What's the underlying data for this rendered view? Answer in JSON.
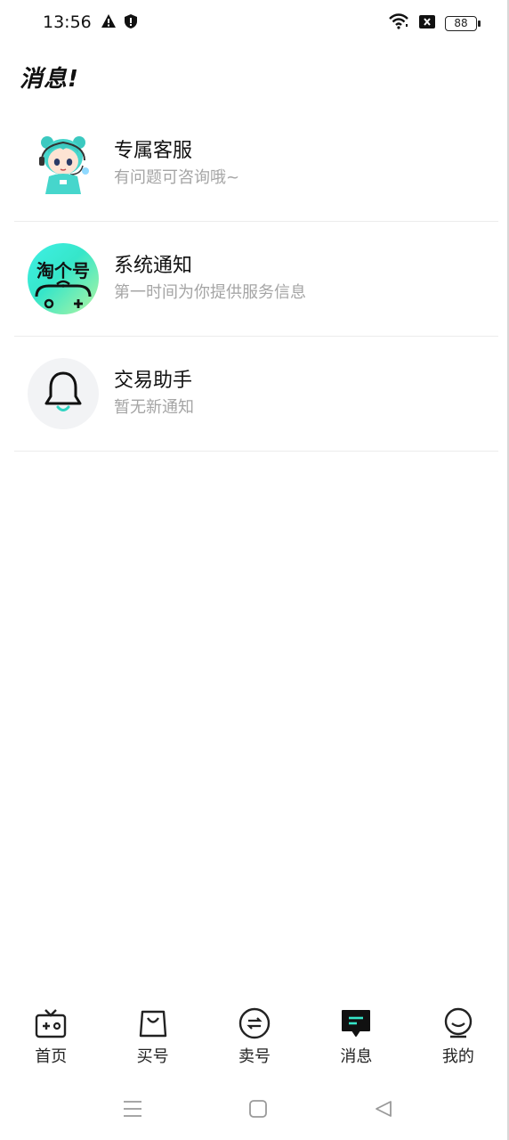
{
  "status_bar": {
    "time": "13:56",
    "battery": "88"
  },
  "page": {
    "title": "消息!"
  },
  "messages": [
    {
      "title": "专属客服",
      "subtitle": "有问题可咨询哦~",
      "avatar_icon": "customer-service-avatar"
    },
    {
      "title": "系统通知",
      "subtitle": "第一时间为你提供服务信息",
      "avatar_icon": "taogehao-logo",
      "avatar_text": "淘个号"
    },
    {
      "title": "交易助手",
      "subtitle": "暂无新通知",
      "avatar_icon": "bell-icon"
    }
  ],
  "tabs": [
    {
      "label": "首页",
      "icon": "home-tv-icon",
      "active": false
    },
    {
      "label": "买号",
      "icon": "shopping-bag-icon",
      "active": false
    },
    {
      "label": "卖号",
      "icon": "exchange-icon",
      "active": false
    },
    {
      "label": "消息",
      "icon": "message-icon",
      "active": true
    },
    {
      "label": "我的",
      "icon": "profile-icon",
      "active": false
    }
  ],
  "colors": {
    "accent": "#36e6c9",
    "text": "#111111",
    "subtext": "#a5a5a5"
  }
}
